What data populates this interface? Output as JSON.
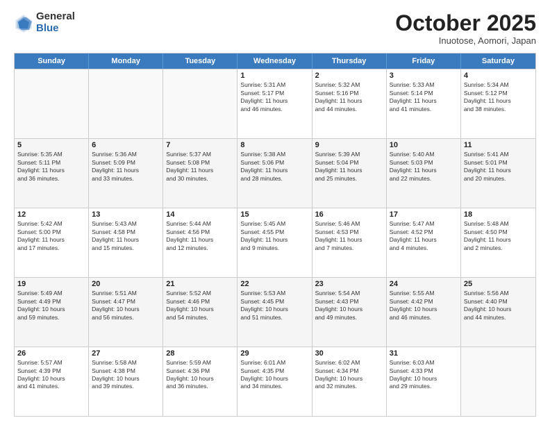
{
  "logo": {
    "general": "General",
    "blue": "Blue"
  },
  "title": "October 2025",
  "subtitle": "Inuotose, Aomori, Japan",
  "headers": [
    "Sunday",
    "Monday",
    "Tuesday",
    "Wednesday",
    "Thursday",
    "Friday",
    "Saturday"
  ],
  "weeks": [
    [
      {
        "day": "",
        "info": ""
      },
      {
        "day": "",
        "info": ""
      },
      {
        "day": "",
        "info": ""
      },
      {
        "day": "1",
        "info": "Sunrise: 5:31 AM\nSunset: 5:17 PM\nDaylight: 11 hours\nand 46 minutes."
      },
      {
        "day": "2",
        "info": "Sunrise: 5:32 AM\nSunset: 5:16 PM\nDaylight: 11 hours\nand 44 minutes."
      },
      {
        "day": "3",
        "info": "Sunrise: 5:33 AM\nSunset: 5:14 PM\nDaylight: 11 hours\nand 41 minutes."
      },
      {
        "day": "4",
        "info": "Sunrise: 5:34 AM\nSunset: 5:12 PM\nDaylight: 11 hours\nand 38 minutes."
      }
    ],
    [
      {
        "day": "5",
        "info": "Sunrise: 5:35 AM\nSunset: 5:11 PM\nDaylight: 11 hours\nand 36 minutes."
      },
      {
        "day": "6",
        "info": "Sunrise: 5:36 AM\nSunset: 5:09 PM\nDaylight: 11 hours\nand 33 minutes."
      },
      {
        "day": "7",
        "info": "Sunrise: 5:37 AM\nSunset: 5:08 PM\nDaylight: 11 hours\nand 30 minutes."
      },
      {
        "day": "8",
        "info": "Sunrise: 5:38 AM\nSunset: 5:06 PM\nDaylight: 11 hours\nand 28 minutes."
      },
      {
        "day": "9",
        "info": "Sunrise: 5:39 AM\nSunset: 5:04 PM\nDaylight: 11 hours\nand 25 minutes."
      },
      {
        "day": "10",
        "info": "Sunrise: 5:40 AM\nSunset: 5:03 PM\nDaylight: 11 hours\nand 22 minutes."
      },
      {
        "day": "11",
        "info": "Sunrise: 5:41 AM\nSunset: 5:01 PM\nDaylight: 11 hours\nand 20 minutes."
      }
    ],
    [
      {
        "day": "12",
        "info": "Sunrise: 5:42 AM\nSunset: 5:00 PM\nDaylight: 11 hours\nand 17 minutes."
      },
      {
        "day": "13",
        "info": "Sunrise: 5:43 AM\nSunset: 4:58 PM\nDaylight: 11 hours\nand 15 minutes."
      },
      {
        "day": "14",
        "info": "Sunrise: 5:44 AM\nSunset: 4:56 PM\nDaylight: 11 hours\nand 12 minutes."
      },
      {
        "day": "15",
        "info": "Sunrise: 5:45 AM\nSunset: 4:55 PM\nDaylight: 11 hours\nand 9 minutes."
      },
      {
        "day": "16",
        "info": "Sunrise: 5:46 AM\nSunset: 4:53 PM\nDaylight: 11 hours\nand 7 minutes."
      },
      {
        "day": "17",
        "info": "Sunrise: 5:47 AM\nSunset: 4:52 PM\nDaylight: 11 hours\nand 4 minutes."
      },
      {
        "day": "18",
        "info": "Sunrise: 5:48 AM\nSunset: 4:50 PM\nDaylight: 11 hours\nand 2 minutes."
      }
    ],
    [
      {
        "day": "19",
        "info": "Sunrise: 5:49 AM\nSunset: 4:49 PM\nDaylight: 10 hours\nand 59 minutes."
      },
      {
        "day": "20",
        "info": "Sunrise: 5:51 AM\nSunset: 4:47 PM\nDaylight: 10 hours\nand 56 minutes."
      },
      {
        "day": "21",
        "info": "Sunrise: 5:52 AM\nSunset: 4:46 PM\nDaylight: 10 hours\nand 54 minutes."
      },
      {
        "day": "22",
        "info": "Sunrise: 5:53 AM\nSunset: 4:45 PM\nDaylight: 10 hours\nand 51 minutes."
      },
      {
        "day": "23",
        "info": "Sunrise: 5:54 AM\nSunset: 4:43 PM\nDaylight: 10 hours\nand 49 minutes."
      },
      {
        "day": "24",
        "info": "Sunrise: 5:55 AM\nSunset: 4:42 PM\nDaylight: 10 hours\nand 46 minutes."
      },
      {
        "day": "25",
        "info": "Sunrise: 5:56 AM\nSunset: 4:40 PM\nDaylight: 10 hours\nand 44 minutes."
      }
    ],
    [
      {
        "day": "26",
        "info": "Sunrise: 5:57 AM\nSunset: 4:39 PM\nDaylight: 10 hours\nand 41 minutes."
      },
      {
        "day": "27",
        "info": "Sunrise: 5:58 AM\nSunset: 4:38 PM\nDaylight: 10 hours\nand 39 minutes."
      },
      {
        "day": "28",
        "info": "Sunrise: 5:59 AM\nSunset: 4:36 PM\nDaylight: 10 hours\nand 36 minutes."
      },
      {
        "day": "29",
        "info": "Sunrise: 6:01 AM\nSunset: 4:35 PM\nDaylight: 10 hours\nand 34 minutes."
      },
      {
        "day": "30",
        "info": "Sunrise: 6:02 AM\nSunset: 4:34 PM\nDaylight: 10 hours\nand 32 minutes."
      },
      {
        "day": "31",
        "info": "Sunrise: 6:03 AM\nSunset: 4:33 PM\nDaylight: 10 hours\nand 29 minutes."
      },
      {
        "day": "",
        "info": ""
      }
    ]
  ]
}
